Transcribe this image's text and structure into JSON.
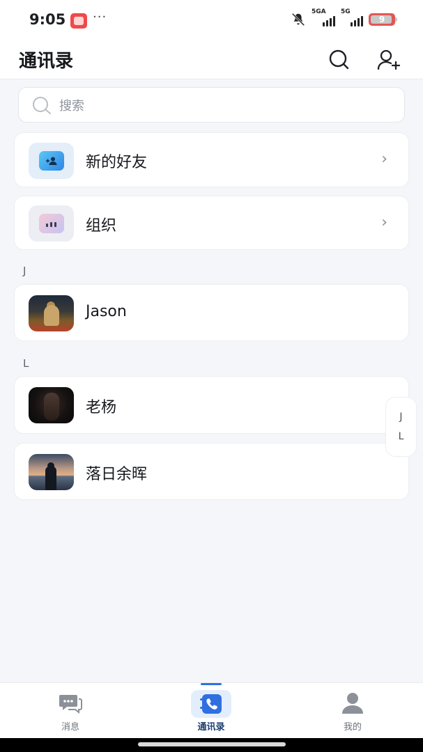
{
  "status_bar": {
    "time": "9:05",
    "dots": "···",
    "signal1_label": "5GA",
    "signal2_label": "5G",
    "battery": "9"
  },
  "header": {
    "title": "通讯录"
  },
  "search": {
    "placeholder": "搜索"
  },
  "entries": {
    "new_friends": "新的好友",
    "organization": "组织"
  },
  "sections": [
    {
      "letter": "J",
      "contacts": [
        {
          "name": "Jason"
        }
      ]
    },
    {
      "letter": "L",
      "contacts": [
        {
          "name": "老杨"
        },
        {
          "name": "落日余晖"
        }
      ]
    }
  ],
  "index_rail": [
    "J",
    "L"
  ],
  "tabbar": {
    "messages": "消息",
    "contacts": "通讯录",
    "me": "我的",
    "active": "contacts"
  },
  "colors": {
    "accent": "#2f6fe0",
    "background": "#f4f6f9"
  }
}
